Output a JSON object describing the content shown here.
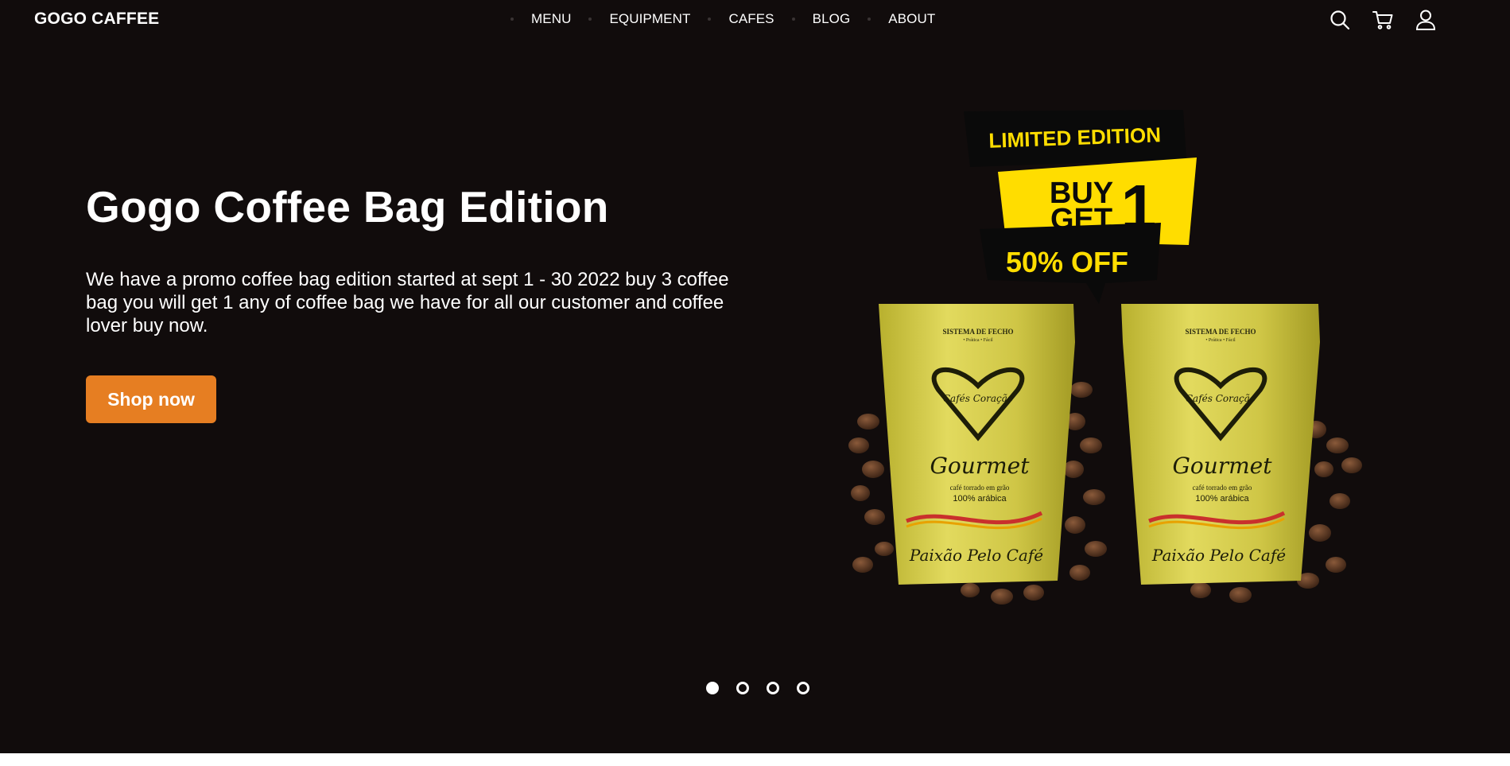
{
  "brand": {
    "logo_text": "GOGO CAFFEE"
  },
  "nav": {
    "links": [
      {
        "label": "MENU"
      },
      {
        "label": "EQUIPMENT"
      },
      {
        "label": "CAFES"
      },
      {
        "label": "BLOG"
      },
      {
        "label": "ABOUT"
      }
    ],
    "icons": [
      "search-icon",
      "cart-icon",
      "user-icon"
    ]
  },
  "hero": {
    "title": "Gogo Coffee Bag Edition",
    "description": "We have a promo coffee bag edition started at sept 1 - 30 2022 buy 3 coffee bag you will get 1 any of coffee bag we have for all our customer and coffee lover buy now.",
    "cta_label": "Shop now"
  },
  "promo": {
    "badge_top": "LIMITED EDITION",
    "badge_mid_line1": "BUY",
    "badge_mid_line2": "GET",
    "badge_mid_number": "1",
    "badge_bottom": "50% OFF",
    "bag_header": "SISTEMA DE FECHO",
    "bag_subheader": "• Prática • Fácil",
    "bag_brand_script": "Gourmet",
    "bag_logo_text": "Cafés Coração",
    "bag_line1": "café torrado em grão",
    "bag_line2": "100% arábica",
    "bag_footer": "Paixão Pelo Café"
  },
  "carousel": {
    "slide_count": 4,
    "active_index": 0
  },
  "colors": {
    "background": "#110c0c",
    "accent": "#e67e22",
    "badge_yellow": "#ffdd00",
    "bag_gold": "#c9c23a"
  }
}
